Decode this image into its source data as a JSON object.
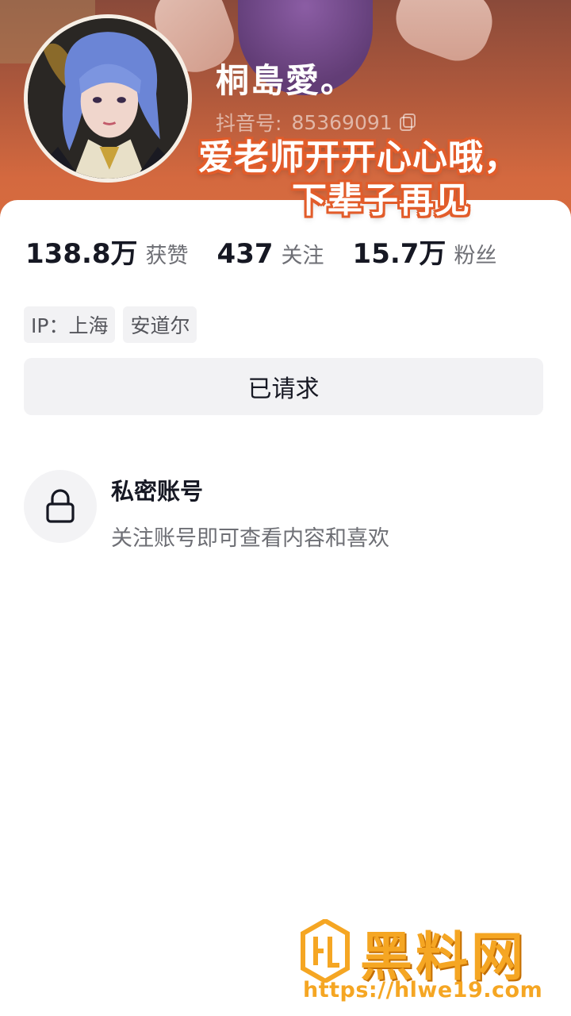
{
  "profile": {
    "username": "桐島愛。",
    "douyin_id_label": "抖音号:",
    "douyin_id": "85369091"
  },
  "caption": {
    "line1": "爱老师开开心心哦，",
    "line2": "下辈子再见"
  },
  "stats": [
    {
      "value": "138.8万",
      "label": "获赞"
    },
    {
      "value": "437",
      "label": "关注"
    },
    {
      "value": "15.7万",
      "label": "粉丝"
    }
  ],
  "tags": [
    "IP：上海",
    "安道尔"
  ],
  "action": {
    "requested_label": "已请求"
  },
  "private_account": {
    "title": "私密账号",
    "description": "关注账号即可查看内容和喜欢"
  },
  "watermark": {
    "title": "黑料网",
    "url": "https://hlwe19.com"
  },
  "colors": {
    "header_top": "#8a4a3a",
    "header_bottom": "#d86c3e",
    "caption_outline": "#e25c2a",
    "watermark": "#f5a623",
    "text_primary": "#161823",
    "text_secondary": "#6e6f75"
  }
}
